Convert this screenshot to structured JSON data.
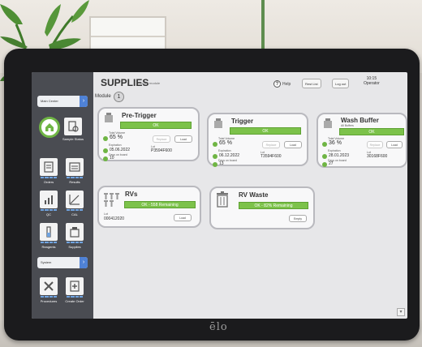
{
  "device": {
    "brand": "ēlo"
  },
  "sidebar": {
    "top_select": "Main Center",
    "mid_select": "System",
    "nav": [
      {
        "label": "Sample Status",
        "icon": "sample-status-icon"
      },
      {
        "label": "Orders",
        "icon": "orders-icon"
      },
      {
        "label": "Results",
        "icon": "results-icon"
      },
      {
        "label": "QC",
        "icon": "qc-icon"
      },
      {
        "label": "CAL",
        "icon": "calibration-icon"
      },
      {
        "label": "Reagents",
        "icon": "reagents-icon"
      },
      {
        "label": "Supplies",
        "icon": "supplies-icon"
      },
      {
        "label": "Procedures",
        "icon": "procedures-icon"
      },
      {
        "label": "Create Order",
        "icon": "create-order-icon"
      }
    ]
  },
  "header": {
    "title": "SUPPLIES",
    "subtitle": "/ Active module",
    "module_label": "Module",
    "module_number": "1",
    "help_label": "Help",
    "btn_1": "Rest List",
    "btn_2": "Log out",
    "clock_time": "10:15",
    "clock_date": "",
    "clock_user": "Operator"
  },
  "cards": {
    "pretrigger": {
      "title": "Pre-Trigger",
      "status": "OK",
      "level_label": "Total Volume",
      "level": "65 %",
      "expiry_label": "Expiration",
      "expiry": "05.06.2022",
      "lot_label": "Lot",
      "lot": "P3594F600",
      "count_label": "Days on board",
      "count": "10",
      "btn_1": "Replace",
      "btn_2": "Load"
    },
    "trigger": {
      "title": "Trigger",
      "status": "OK",
      "level_label": "Total Volume",
      "level": "65 %",
      "expiry_label": "Expiration",
      "expiry": "06.12.2022",
      "lot_label": "Lot",
      "lot": "T3594F600",
      "count_label": "Days on board",
      "count": "13",
      "btn_1": "Replace",
      "btn_2": "Load"
    },
    "washbuffer": {
      "title": "Wash Buffer",
      "subtitle": "All Buffers",
      "status": "OK",
      "level_label": "Total Volume",
      "level": "36 %",
      "expiry_label": "Expiration",
      "expiry": "28.01.2023",
      "lot_label": "Lot",
      "lot": "30168F600",
      "count_label": "Days on board",
      "count": "27",
      "btn_1": "Replace",
      "btn_2": "Load"
    },
    "rvs": {
      "title": "RVs",
      "status": "OK - 558 Remaining",
      "lot_label": "Lot",
      "lot": "000412020",
      "btn": "Load"
    },
    "rvwaste": {
      "title": "RV Waste",
      "status": "OK - 82% Remaining",
      "btn": "Empty"
    }
  },
  "colors": {
    "ok_green": "#7cc24a",
    "sidebar": "#4a4c52",
    "accent_blue": "#4f82d6"
  }
}
